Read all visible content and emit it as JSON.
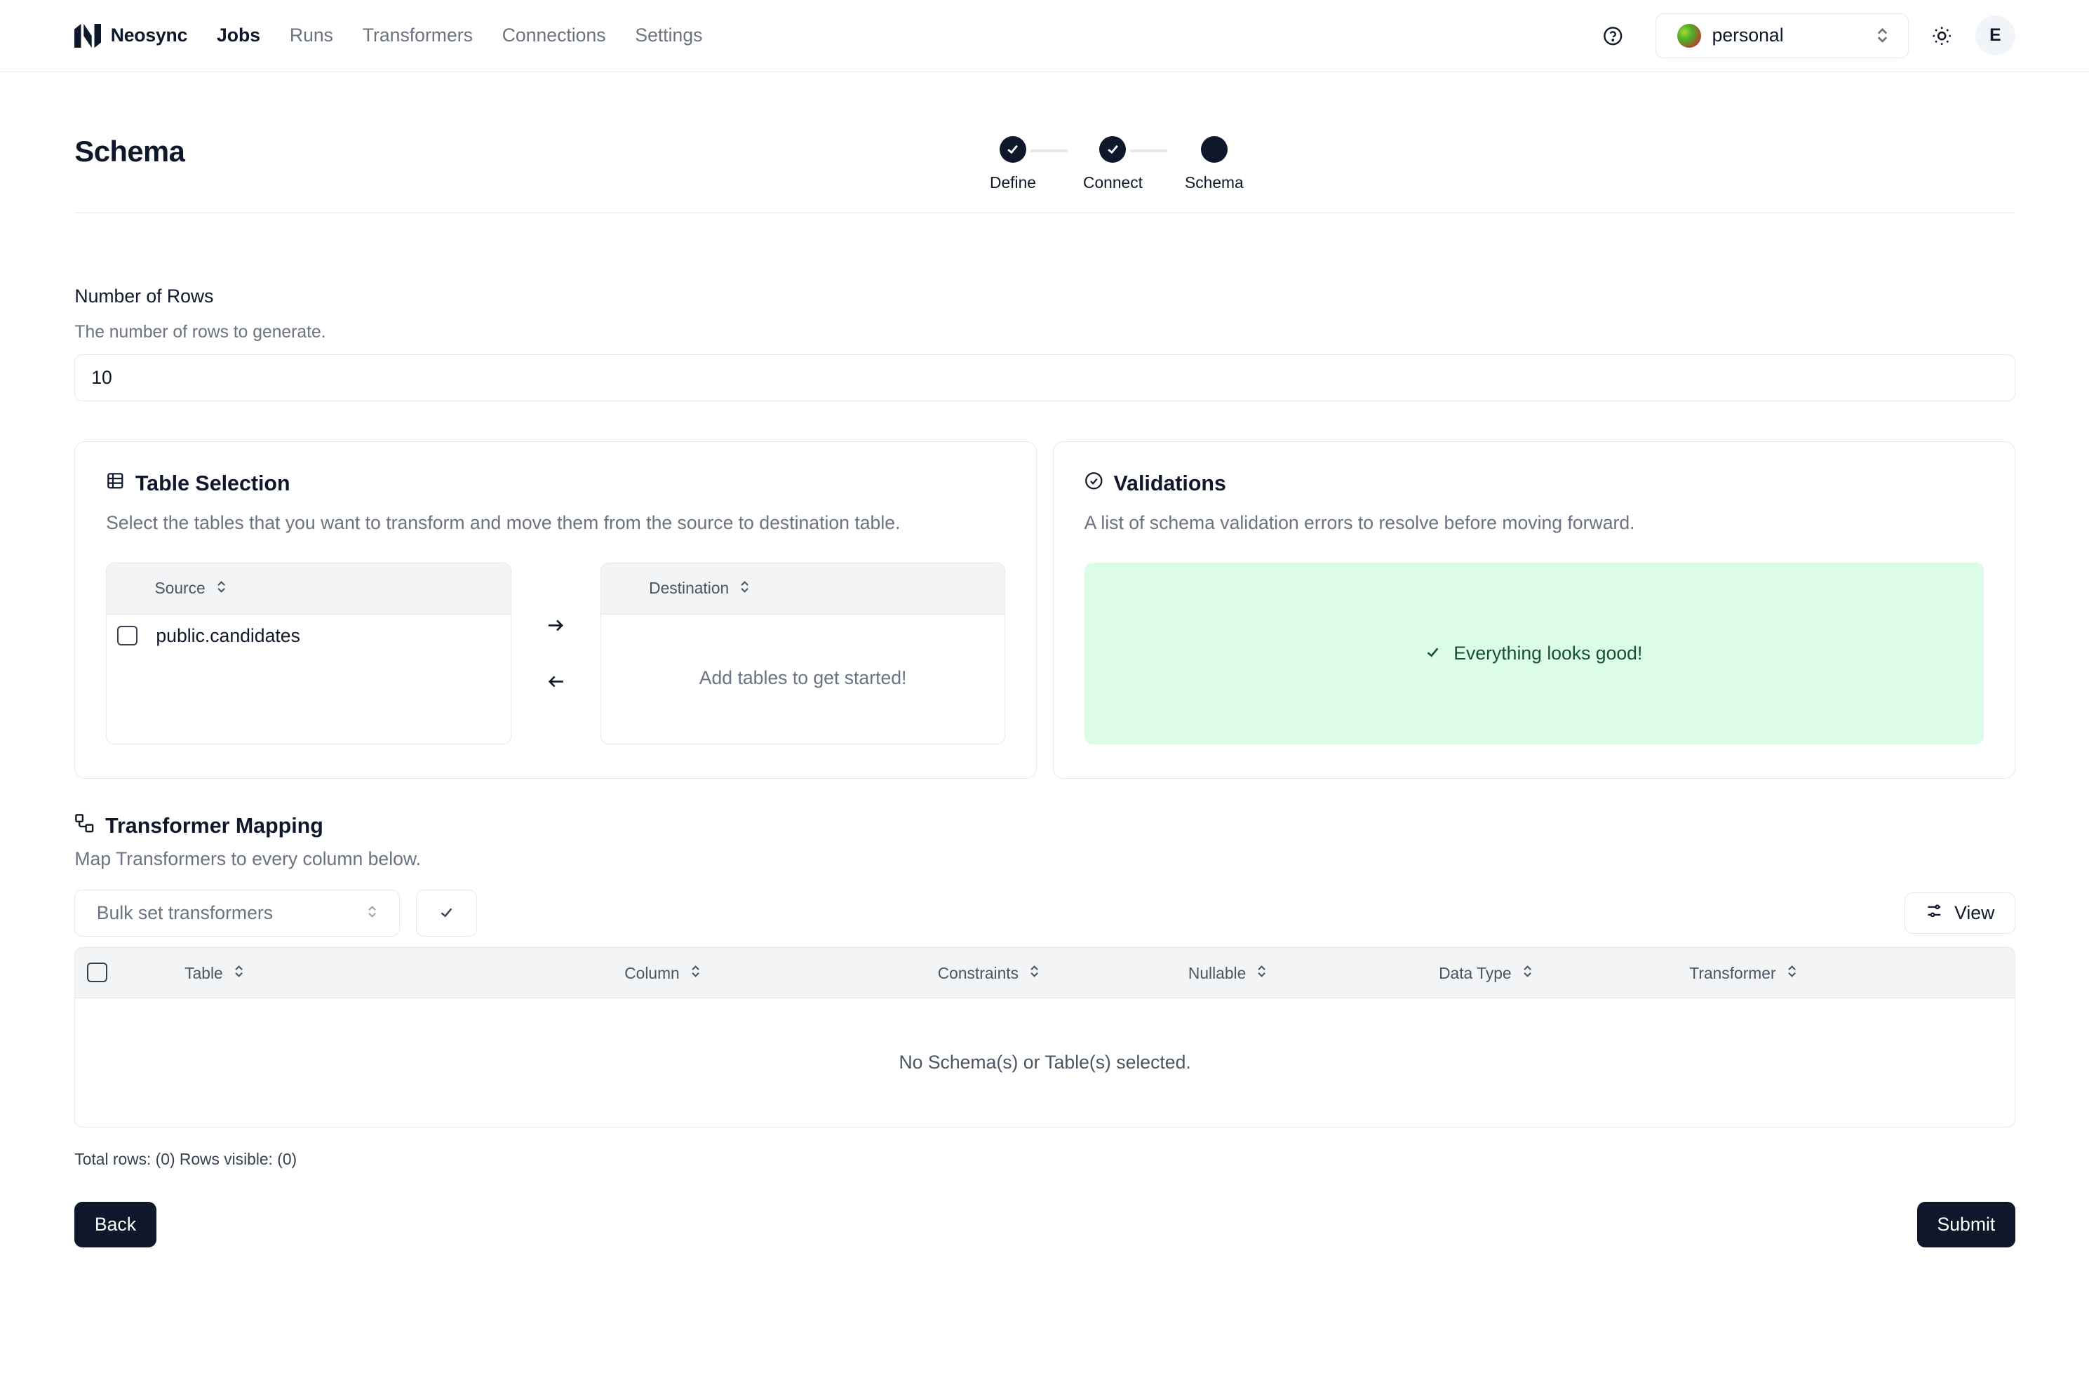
{
  "nav": {
    "brand": "Neosync",
    "links": [
      "Jobs",
      "Runs",
      "Transformers",
      "Connections",
      "Settings"
    ],
    "account": "personal",
    "user_initial": "E"
  },
  "header": {
    "title": "Schema",
    "steps": [
      "Define",
      "Connect",
      "Schema"
    ]
  },
  "rows_field": {
    "label": "Number of Rows",
    "description": "The number of rows to generate.",
    "value": "10"
  },
  "table_selection": {
    "title": "Table Selection",
    "description": "Select the tables that you want to transform and move them from the source to destination table.",
    "source_header": "Source",
    "destination_header": "Destination",
    "source_items": [
      "public.candidates"
    ],
    "destination_empty": "Add tables to get started!"
  },
  "validations": {
    "title": "Validations",
    "description": "A list of schema validation errors to resolve before moving forward.",
    "status": "Everything looks good!"
  },
  "mapping": {
    "title": "Transformer Mapping",
    "description": "Map Transformers to every column below.",
    "bulk_placeholder": "Bulk set transformers",
    "view_label": "View",
    "columns": [
      "Table",
      "Column",
      "Constraints",
      "Nullable",
      "Data Type",
      "Transformer"
    ],
    "empty": "No Schema(s) or Table(s) selected.",
    "footer": "Total rows: (0) Rows visible: (0)"
  },
  "actions": {
    "back": "Back",
    "submit": "Submit"
  }
}
